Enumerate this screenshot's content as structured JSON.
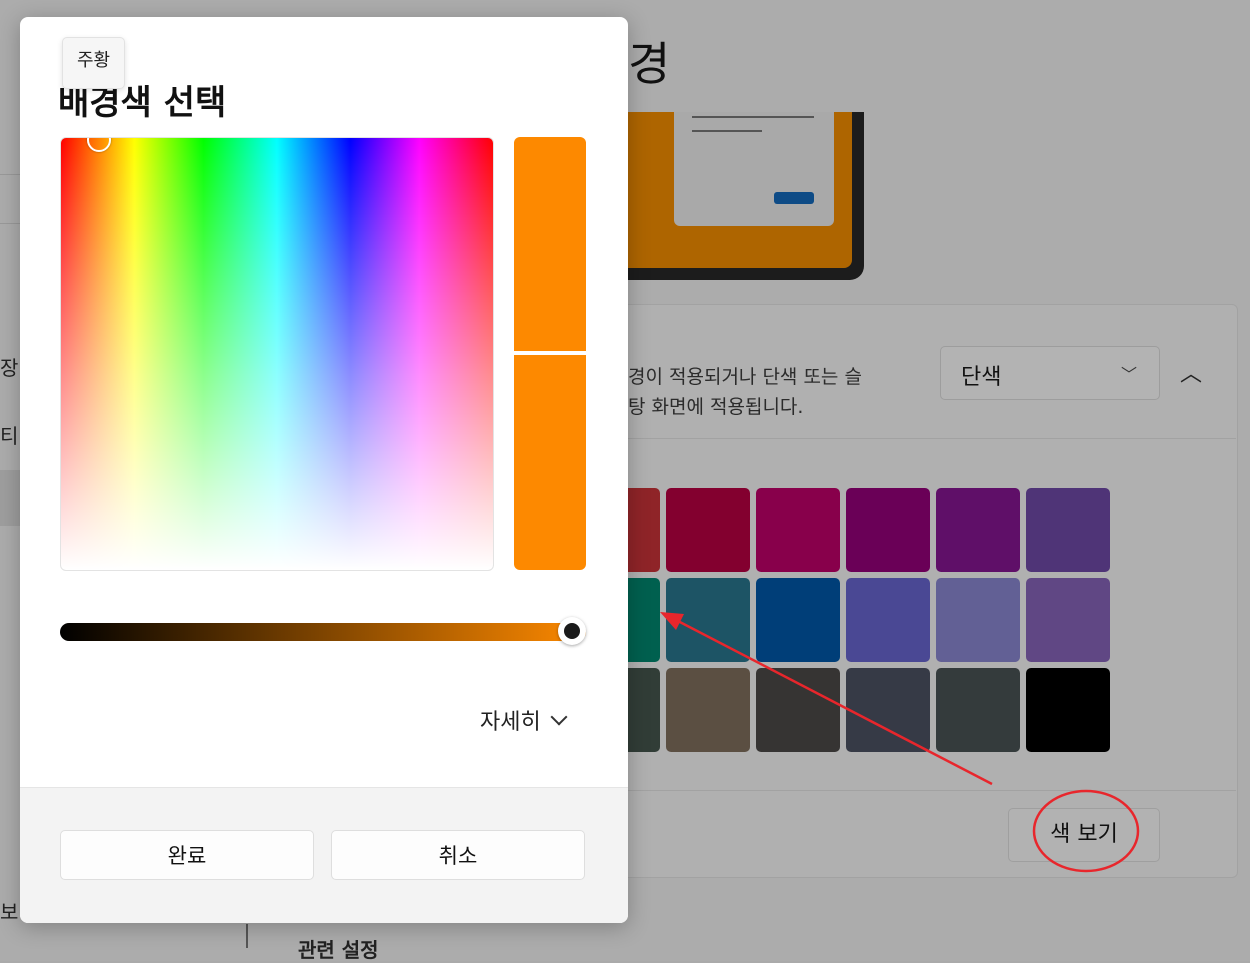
{
  "background": {
    "page_title": "경",
    "sidebar_fragments": [
      "장",
      "티",
      "보"
    ],
    "description_line1": "경이 적용되거나 단색 또는 슬",
    "description_line2": "탕 화면에 적용됩니다.",
    "background_type_dropdown": "단색",
    "swatches": [
      [
        "#8f2428",
        "#83002f",
        "#88004b",
        "#6a0057",
        "#5f0f68",
        "#4f3477"
      ],
      [
        "#00604f",
        "#1d5465",
        "#003e78",
        "#4a4894",
        "#626095",
        "#604784"
      ],
      [
        "#313d37",
        "#5b4f42",
        "#363433",
        "#363a46",
        "#343b3c",
        "#000000"
      ]
    ],
    "view_color_button": "색 보기",
    "related_settings": "관련 설정"
  },
  "dialog": {
    "title": "배경색 선택",
    "tooltip": "주황",
    "current_color": "#fd8900",
    "more_label": "자세히",
    "done_button": "완료",
    "cancel_button": "취소"
  },
  "annotation": {
    "color": "#e8262c"
  }
}
